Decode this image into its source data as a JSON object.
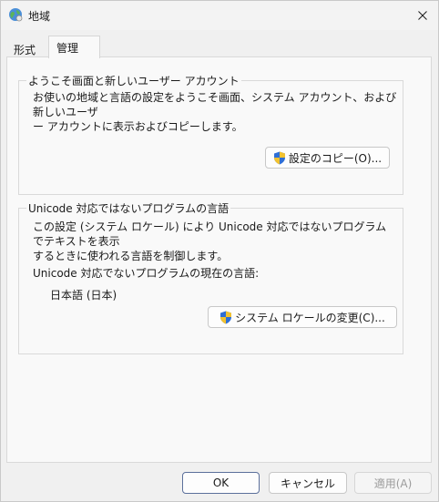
{
  "window": {
    "title": "地域"
  },
  "tabs": [
    {
      "label": "形式"
    },
    {
      "label": "管理"
    }
  ],
  "welcome_group": {
    "title": "ようこそ画面と新しいユーザー アカウント",
    "description_line1": "お使いの地域と言語の設定をようこそ画面、システム アカウント、および新しいユーザ",
    "description_line2": "ー アカウントに表示およびコピーします。",
    "copy_button": "設定のコピー(O)..."
  },
  "unicode_group": {
    "title": "Unicode 対応ではないプログラムの言語",
    "description_line1": "この設定 (システム ロケール) により Unicode 対応ではないプログラムでテキストを表示",
    "description_line2": "するときに使われる言語を制御します。",
    "current_label": "Unicode 対応でないプログラムの現在の言語:",
    "current_value": "日本語 (日本)",
    "change_button": "システム ロケールの変更(C)..."
  },
  "footer": {
    "ok": "OK",
    "cancel": "キャンセル",
    "apply": "適用(A)"
  },
  "colors": {
    "shield_blue": "#2f6fd6",
    "shield_yellow": "#f2c230",
    "accent_border": "#5b6f9a"
  }
}
